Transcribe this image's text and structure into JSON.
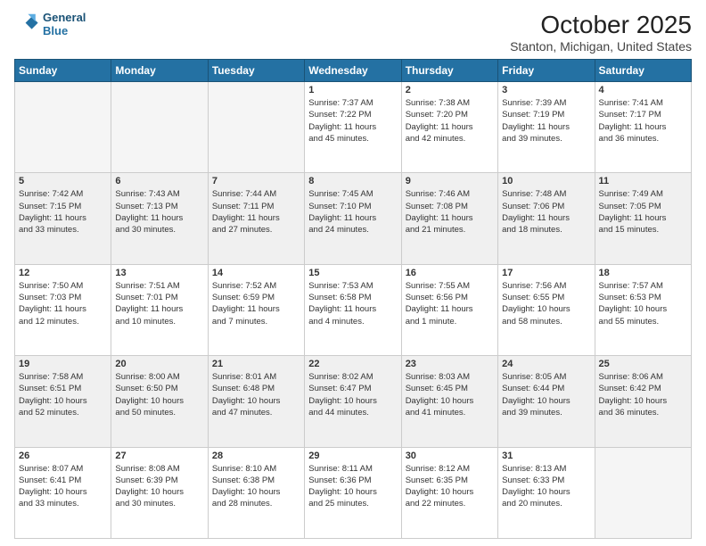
{
  "header": {
    "logo_line1": "General",
    "logo_line2": "Blue",
    "month": "October 2025",
    "location": "Stanton, Michigan, United States"
  },
  "weekdays": [
    "Sunday",
    "Monday",
    "Tuesday",
    "Wednesday",
    "Thursday",
    "Friday",
    "Saturday"
  ],
  "weeks": [
    [
      {
        "day": "",
        "info": ""
      },
      {
        "day": "",
        "info": ""
      },
      {
        "day": "",
        "info": ""
      },
      {
        "day": "1",
        "info": "Sunrise: 7:37 AM\nSunset: 7:22 PM\nDaylight: 11 hours\nand 45 minutes."
      },
      {
        "day": "2",
        "info": "Sunrise: 7:38 AM\nSunset: 7:20 PM\nDaylight: 11 hours\nand 42 minutes."
      },
      {
        "day": "3",
        "info": "Sunrise: 7:39 AM\nSunset: 7:19 PM\nDaylight: 11 hours\nand 39 minutes."
      },
      {
        "day": "4",
        "info": "Sunrise: 7:41 AM\nSunset: 7:17 PM\nDaylight: 11 hours\nand 36 minutes."
      }
    ],
    [
      {
        "day": "5",
        "info": "Sunrise: 7:42 AM\nSunset: 7:15 PM\nDaylight: 11 hours\nand 33 minutes."
      },
      {
        "day": "6",
        "info": "Sunrise: 7:43 AM\nSunset: 7:13 PM\nDaylight: 11 hours\nand 30 minutes."
      },
      {
        "day": "7",
        "info": "Sunrise: 7:44 AM\nSunset: 7:11 PM\nDaylight: 11 hours\nand 27 minutes."
      },
      {
        "day": "8",
        "info": "Sunrise: 7:45 AM\nSunset: 7:10 PM\nDaylight: 11 hours\nand 24 minutes."
      },
      {
        "day": "9",
        "info": "Sunrise: 7:46 AM\nSunset: 7:08 PM\nDaylight: 11 hours\nand 21 minutes."
      },
      {
        "day": "10",
        "info": "Sunrise: 7:48 AM\nSunset: 7:06 PM\nDaylight: 11 hours\nand 18 minutes."
      },
      {
        "day": "11",
        "info": "Sunrise: 7:49 AM\nSunset: 7:05 PM\nDaylight: 11 hours\nand 15 minutes."
      }
    ],
    [
      {
        "day": "12",
        "info": "Sunrise: 7:50 AM\nSunset: 7:03 PM\nDaylight: 11 hours\nand 12 minutes."
      },
      {
        "day": "13",
        "info": "Sunrise: 7:51 AM\nSunset: 7:01 PM\nDaylight: 11 hours\nand 10 minutes."
      },
      {
        "day": "14",
        "info": "Sunrise: 7:52 AM\nSunset: 6:59 PM\nDaylight: 11 hours\nand 7 minutes."
      },
      {
        "day": "15",
        "info": "Sunrise: 7:53 AM\nSunset: 6:58 PM\nDaylight: 11 hours\nand 4 minutes."
      },
      {
        "day": "16",
        "info": "Sunrise: 7:55 AM\nSunset: 6:56 PM\nDaylight: 11 hours\nand 1 minute."
      },
      {
        "day": "17",
        "info": "Sunrise: 7:56 AM\nSunset: 6:55 PM\nDaylight: 10 hours\nand 58 minutes."
      },
      {
        "day": "18",
        "info": "Sunrise: 7:57 AM\nSunset: 6:53 PM\nDaylight: 10 hours\nand 55 minutes."
      }
    ],
    [
      {
        "day": "19",
        "info": "Sunrise: 7:58 AM\nSunset: 6:51 PM\nDaylight: 10 hours\nand 52 minutes."
      },
      {
        "day": "20",
        "info": "Sunrise: 8:00 AM\nSunset: 6:50 PM\nDaylight: 10 hours\nand 50 minutes."
      },
      {
        "day": "21",
        "info": "Sunrise: 8:01 AM\nSunset: 6:48 PM\nDaylight: 10 hours\nand 47 minutes."
      },
      {
        "day": "22",
        "info": "Sunrise: 8:02 AM\nSunset: 6:47 PM\nDaylight: 10 hours\nand 44 minutes."
      },
      {
        "day": "23",
        "info": "Sunrise: 8:03 AM\nSunset: 6:45 PM\nDaylight: 10 hours\nand 41 minutes."
      },
      {
        "day": "24",
        "info": "Sunrise: 8:05 AM\nSunset: 6:44 PM\nDaylight: 10 hours\nand 39 minutes."
      },
      {
        "day": "25",
        "info": "Sunrise: 8:06 AM\nSunset: 6:42 PM\nDaylight: 10 hours\nand 36 minutes."
      }
    ],
    [
      {
        "day": "26",
        "info": "Sunrise: 8:07 AM\nSunset: 6:41 PM\nDaylight: 10 hours\nand 33 minutes."
      },
      {
        "day": "27",
        "info": "Sunrise: 8:08 AM\nSunset: 6:39 PM\nDaylight: 10 hours\nand 30 minutes."
      },
      {
        "day": "28",
        "info": "Sunrise: 8:10 AM\nSunset: 6:38 PM\nDaylight: 10 hours\nand 28 minutes."
      },
      {
        "day": "29",
        "info": "Sunrise: 8:11 AM\nSunset: 6:36 PM\nDaylight: 10 hours\nand 25 minutes."
      },
      {
        "day": "30",
        "info": "Sunrise: 8:12 AM\nSunset: 6:35 PM\nDaylight: 10 hours\nand 22 minutes."
      },
      {
        "day": "31",
        "info": "Sunrise: 8:13 AM\nSunset: 6:33 PM\nDaylight: 10 hours\nand 20 minutes."
      },
      {
        "day": "",
        "info": ""
      }
    ]
  ]
}
